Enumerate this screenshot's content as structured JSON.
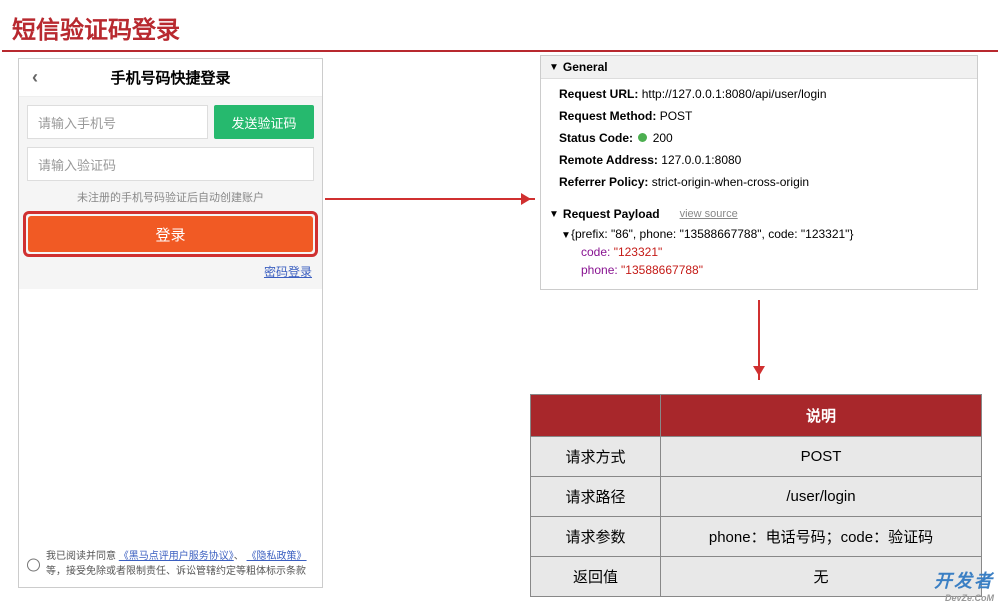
{
  "title": "短信验证码登录",
  "mobile": {
    "header": "手机号码快捷登录",
    "phone_placeholder": "请输入手机号",
    "send_code_btn": "发送验证码",
    "code_placeholder": "请输入验证码",
    "hint": "未注册的手机号码验证后自动创建账户",
    "login_btn": "登录",
    "pwd_login": "密码登录",
    "agreement_prefix": "我已阅读并同意",
    "agreement_link1": "《黑马点评用户服务协议》",
    "agreement_sep": "、",
    "agreement_link2": "《隐私政策》",
    "agreement_suffix": "等，接受免除或者限制责任、诉讼管辖约定等粗体标示条款"
  },
  "devtools": {
    "general_label": "General",
    "request_url_label": "Request URL:",
    "request_url": "http://127.0.0.1:8080/api/user/login",
    "request_method_label": "Request Method:",
    "request_method": "POST",
    "status_code_label": "Status Code:",
    "status_code": "200",
    "remote_addr_label": "Remote Address:",
    "remote_addr": "127.0.0.1:8080",
    "referrer_label": "Referrer Policy:",
    "referrer": "strict-origin-when-cross-origin",
    "payload_label": "Request Payload",
    "view_source": "view source",
    "payload_summary": "{prefix: \"86\", phone: \"13588667788\", code: \"123321\"}",
    "code_key": "code:",
    "code_val": "\"123321\"",
    "phone_key": "phone:",
    "phone_val": "\"13588667788\""
  },
  "table": {
    "header_desc": "说明",
    "rows": [
      {
        "label": "请求方式",
        "value": "POST"
      },
      {
        "label": "请求路径",
        "value": "/user/login"
      },
      {
        "label": "请求参数",
        "value": "phone：电话号码；code：验证码"
      },
      {
        "label": "返回值",
        "value": "无"
      }
    ]
  },
  "watermark": "开发者",
  "watermark_sub": "DevZe.CoM"
}
